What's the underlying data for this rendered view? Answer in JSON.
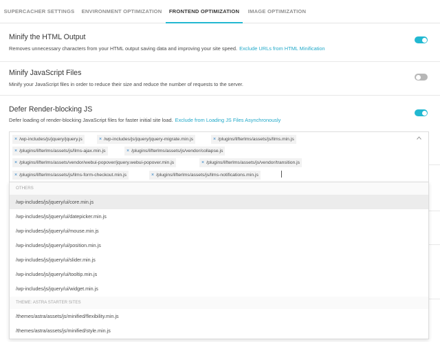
{
  "tabs": [
    {
      "label": "SUPERCACHER SETTINGS",
      "active": false
    },
    {
      "label": "ENVIRONMENT OPTIMIZATION",
      "active": false
    },
    {
      "label": "FRONTEND OPTIMIZATION",
      "active": true
    },
    {
      "label": "IMAGE OPTIMIZATION",
      "active": false
    }
  ],
  "minify_html": {
    "title": "Minify the HTML Output",
    "desc": "Removes unnecessary characters from your HTML output saving data and improving your site speed.",
    "link": "Exclude URLs from HTML Minification",
    "enabled": true
  },
  "minify_js": {
    "title": "Minify JavaScript Files",
    "desc": "Minify your JavaScript files in order to reduce their size and reduce the number of requests to the server.",
    "enabled": false
  },
  "defer_js": {
    "title": "Defer Render-blocking JS",
    "desc": "Defer loading of render-blocking JavaScript files for faster initial site load.",
    "link": "Exclude from Loading JS Files Asynchronously",
    "enabled": true
  },
  "selected": [
    "/wp-includes/js/jquery/jquery.js",
    "/wp-includes/js/jquery/jquery-migrate.min.js",
    "/plugins/lifterlms/assets/js/llms.min.js",
    "/plugins/lifterlms/assets/js/llms-ajax.min.js",
    "/plugins/lifterlms/assets/js/vendor/collapse.js",
    "/plugins/lifterlms/assets/vendor/webui-popover/jquery.webui-popover.min.js",
    "/plugins/lifterlms/assets/js/vendor/transition.js",
    "/plugins/lifterlms/assets/js/llms-form-checkout.min.js",
    "/plugins/lifterlms/assets/js/llms-notifications.min.js"
  ],
  "remove_glyph": "×",
  "dropdown": {
    "group_others": "OTHERS",
    "others": [
      "/wp-includes/js/jquery/ui/core.min.js",
      "/wp-includes/js/jquery/ui/datepicker.min.js",
      "/wp-includes/js/jquery/ui/mouse.min.js",
      "/wp-includes/js/jquery/ui/position.min.js",
      "/wp-includes/js/jquery/ui/slider.min.js",
      "/wp-includes/js/jquery/ui/tooltip.min.js",
      "/wp-includes/js/jquery/ui/widget.min.js"
    ],
    "group_theme": "THEME: ASTRA STARTER SITES",
    "theme": [
      "/themes/astra/assets/js/minified/flexibility.min.js",
      "/themes/astra/assets/js/minified/style.min.js"
    ]
  },
  "colors": {
    "accent": "#22b8d1",
    "link": "#22a9c9",
    "toggle_off": "#b7b7b7"
  },
  "icons": {
    "dropdown_caret": "chevron-up-icon",
    "chip_remove": "close-icon"
  }
}
